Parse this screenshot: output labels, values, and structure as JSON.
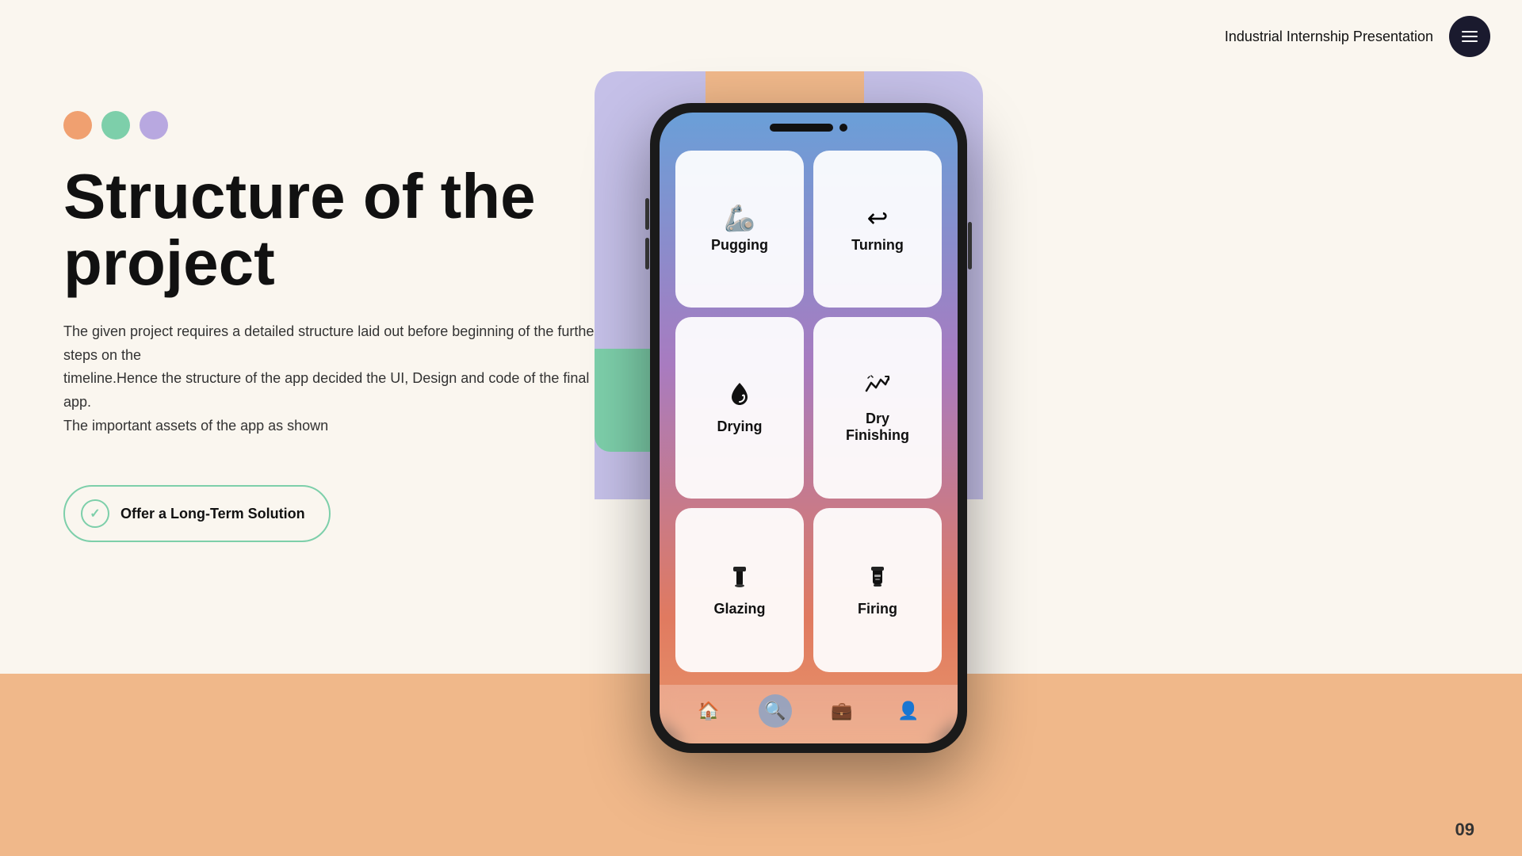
{
  "header": {
    "title": "Industrial Internship Presentation",
    "menu_label": "menu"
  },
  "left": {
    "dots": [
      {
        "color": "orange",
        "label": "dot-orange"
      },
      {
        "color": "green",
        "label": "dot-green"
      },
      {
        "color": "purple",
        "label": "dot-purple"
      }
    ],
    "title_line1": "Structure of the",
    "title_line2": "project",
    "description": "The given project requires a detailed structure laid out before beginning of the further steps on the\ntimeline.Hence the structure of the app decided the UI, Design and code of the final app.\nThe important assets of the app as shown",
    "cta_label": "Offer a Long-Term Solution"
  },
  "phone": {
    "apps": [
      {
        "label": "Pugging",
        "icon": "🦾"
      },
      {
        "label": "Turning",
        "icon": "↩"
      },
      {
        "label": "Drying",
        "icon": "💧"
      },
      {
        "label": "Dry Finishing",
        "icon": "📈"
      },
      {
        "label": "Glazing",
        "icon": "🖌"
      },
      {
        "label": "Firing",
        "icon": "🧯"
      }
    ],
    "nav_items": [
      {
        "icon": "🏠",
        "active": false
      },
      {
        "icon": "🔍",
        "active": true
      },
      {
        "icon": "💼",
        "active": false
      },
      {
        "icon": "👤",
        "active": false
      }
    ]
  },
  "page_number": "09"
}
